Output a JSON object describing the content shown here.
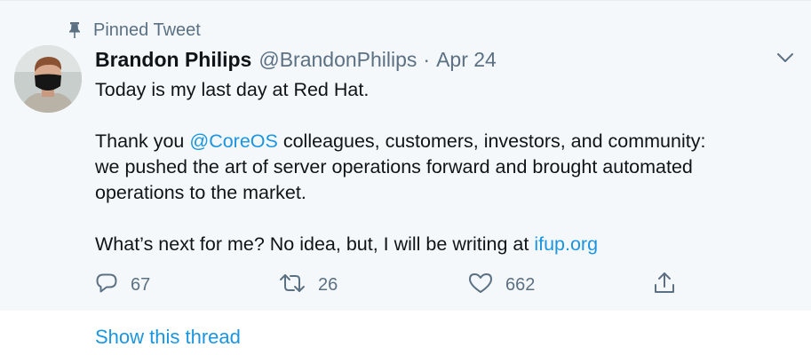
{
  "pinned": {
    "label": "Pinned Tweet",
    "icon": "pin-icon"
  },
  "author": {
    "name": "Brandon Philips",
    "handle": "@BrandonPhilips",
    "separator": "·",
    "date": "Apr 24"
  },
  "tweet": {
    "line1": "Today is my last day at Red Hat.",
    "p2_a": "Thank you ",
    "p2_mention": "@CoreOS",
    "p2_b": " colleagues, customers, investors, and community:",
    "line3": "we pushed the art of server operations forward and brought automated",
    "line4": "operations to the market.",
    "p5_a": "What’s next for me? No idea, but, I will be writing at ",
    "p5_link": "ifup.org"
  },
  "actions": {
    "reply": {
      "icon": "reply-icon",
      "count": "67"
    },
    "retweet": {
      "icon": "retweet-icon",
      "count": "26"
    },
    "like": {
      "icon": "heart-icon",
      "count": "662"
    },
    "share": {
      "icon": "share-icon"
    }
  },
  "show_thread": "Show this thread",
  "colors": {
    "accent": "#1da1f2",
    "link": "#1b95e0",
    "muted": "#5b7083",
    "text": "#0f1419",
    "card_bg": "#f5f8fa"
  }
}
